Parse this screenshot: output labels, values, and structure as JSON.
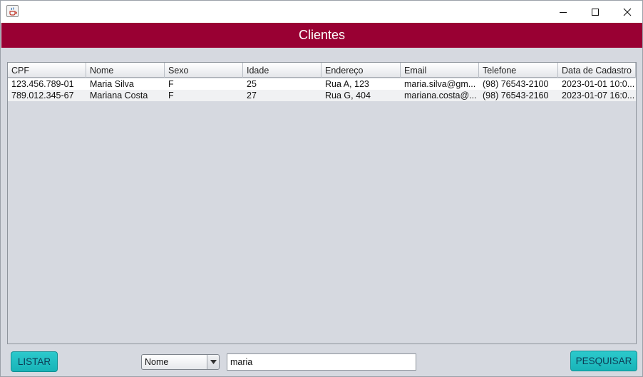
{
  "window": {
    "title": "",
    "icons": {
      "app": "java-cup-icon",
      "minimize": "minimize-icon",
      "maximize": "maximize-icon",
      "close": "close-icon"
    }
  },
  "header": {
    "title": "Clientes"
  },
  "table": {
    "columns": [
      "CPF",
      "Nome",
      "Sexo",
      "Idade",
      "Endereço",
      "Email",
      "Telefone",
      "Data de Cadastro"
    ],
    "rows": [
      [
        "123.456.789-01",
        "Maria Silva",
        "F",
        "25",
        "Rua A, 123",
        "maria.silva@gm...",
        "(98) 76543-2100",
        "2023-01-01 10:0..."
      ],
      [
        "789.012.345-67",
        "Mariana Costa",
        "F",
        "27",
        "Rua G, 404",
        "mariana.costa@...",
        "(98) 76543-2160",
        "2023-01-07 16:0..."
      ]
    ]
  },
  "footer": {
    "list_button": "LISTAR",
    "filter_select": {
      "selected": "Nome"
    },
    "search_value": "maria",
    "search_button": "PESQUISAR"
  },
  "colors": {
    "header_bg": "#990033",
    "button_bg": "#1fbfc2",
    "panel_bg": "#d6d9e0"
  }
}
